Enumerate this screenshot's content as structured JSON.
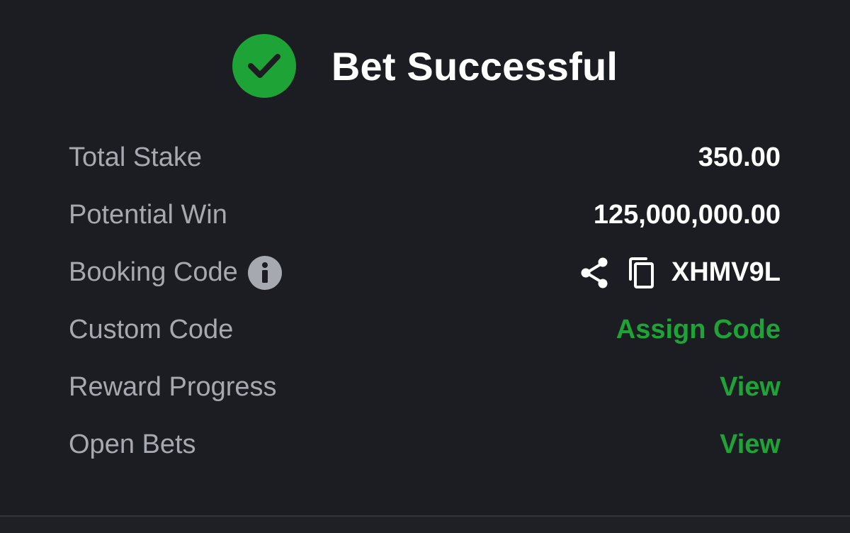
{
  "header": {
    "title": "Bet Successful",
    "status_icon": "check-circle-icon",
    "accent_color": "#1ea436"
  },
  "rows": {
    "total_stake": {
      "label": "Total Stake",
      "value": "350.00"
    },
    "potential_win": {
      "label": "Potential Win",
      "value": "125,000,000.00"
    },
    "booking_code": {
      "label": "Booking Code",
      "value": "XHMV9L",
      "info_icon": "info-icon",
      "share_icon": "share-icon",
      "copy_icon": "copy-icon"
    },
    "custom_code": {
      "label": "Custom Code",
      "action": "Assign Code"
    },
    "reward_progress": {
      "label": "Reward Progress",
      "action": "View"
    },
    "open_bets": {
      "label": "Open Bets",
      "action": "View"
    }
  }
}
